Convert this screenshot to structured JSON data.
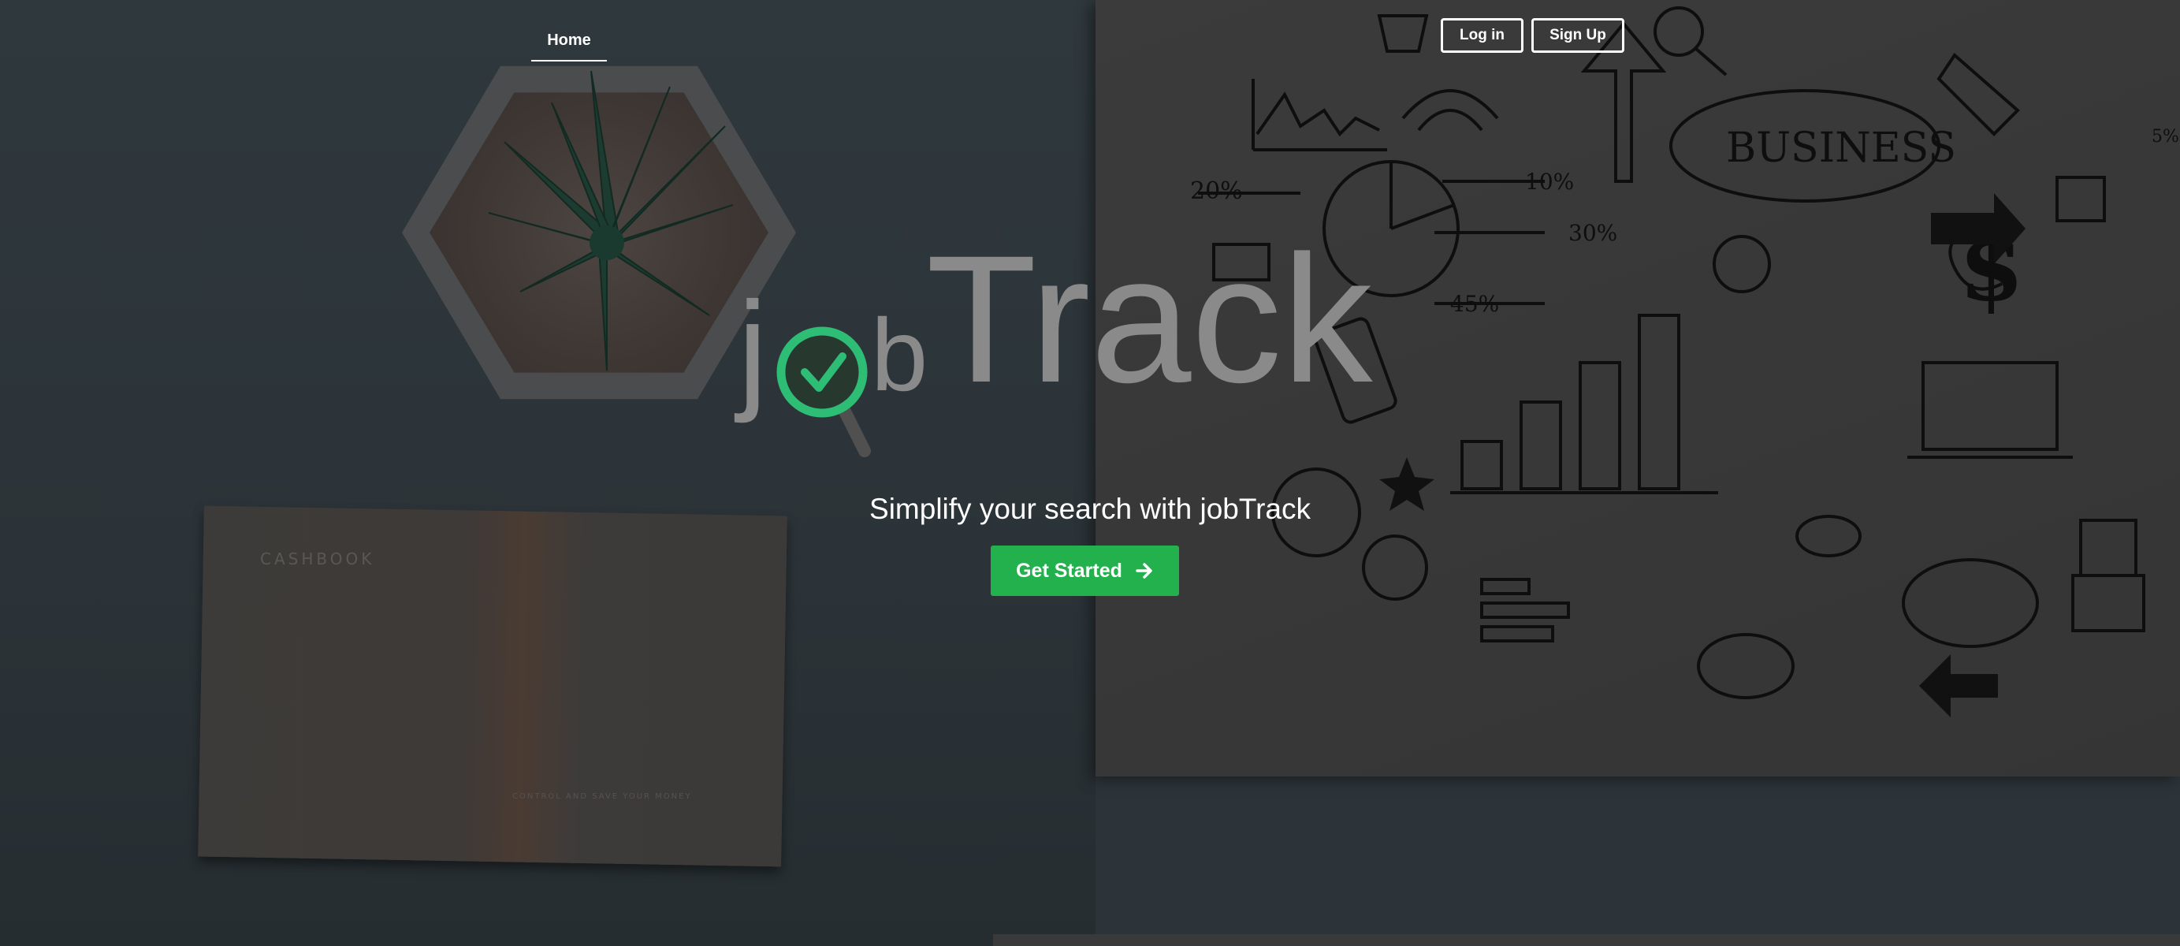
{
  "nav": {
    "home_label": "Home"
  },
  "auth": {
    "login_label": "Log in",
    "signup_label": "Sign Up"
  },
  "logo": {
    "prefix_j": "j",
    "suffix_b": "b",
    "brand_main": "Track"
  },
  "hero": {
    "tagline": "Simplify your search with jobTrack",
    "cta_label": "Get Started",
    "cta_icon": "arrow-right-icon"
  },
  "background": {
    "cashbook_title": "CASHBOOK",
    "cashbook_subtitle": "CONTROL AND SAVE YOUR MONEY",
    "doodle_labels": [
      "BUSINESS",
      "20%",
      "10%",
      "30%",
      "45%",
      "$"
    ]
  },
  "colors": {
    "accent_green": "#22b14c",
    "logo_check_green": "#2ebd74",
    "logo_grey": "#8a8a8a"
  }
}
